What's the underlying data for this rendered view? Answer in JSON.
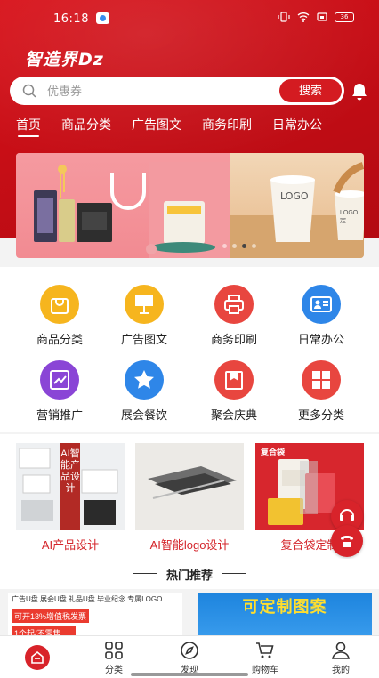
{
  "status_bar": {
    "time": "16:18",
    "battery": "36"
  },
  "app": {
    "logo": "智造界Dz"
  },
  "search": {
    "placeholder": "优惠券",
    "button": "搜索"
  },
  "tabs": [
    {
      "label": "首页",
      "active": true
    },
    {
      "label": "商品分类",
      "active": false
    },
    {
      "label": "广告图文",
      "active": false
    },
    {
      "label": "商务印刷",
      "active": false
    },
    {
      "label": "日常办公",
      "active": false
    }
  ],
  "banner": {
    "logo_text": "LOGO",
    "cup_text": "LOGO定"
  },
  "categories": [
    {
      "label": "商品分类",
      "icon": "shopping-bag-icon",
      "color": "#f6b51e"
    },
    {
      "label": "广告图文",
      "icon": "billboard-icon",
      "color": "#f6b51e"
    },
    {
      "label": "商务印刷",
      "icon": "printer-icon",
      "color": "#e8463f"
    },
    {
      "label": "日常办公",
      "icon": "id-card-icon",
      "color": "#2e86e8"
    },
    {
      "label": "营销推广",
      "icon": "trend-chart-icon",
      "color": "#8a45d6"
    },
    {
      "label": "展会餐饮",
      "icon": "star-icon",
      "color": "#2e86e8"
    },
    {
      "label": "聚会庆典",
      "icon": "gift-icon",
      "color": "#e8463f"
    },
    {
      "label": "更多分类",
      "icon": "grid-icon",
      "color": "#e8463f"
    }
  ],
  "promos": [
    {
      "caption": "AI产品设计",
      "overlay": "AI智能产品设计"
    },
    {
      "caption": "AI智能logo设计"
    },
    {
      "caption": "复合袋定制",
      "tag": "复合袋"
    }
  ],
  "hot": {
    "title": "热门推荐"
  },
  "goods": {
    "left": {
      "chips": "广告U盘  展会U盘  礼品U盘  毕业纪念  专属LOGO",
      "badge1": "可开13%增值税发票",
      "badge2": "1个起/不零售"
    },
    "right": {
      "title": "可定制图案"
    }
  },
  "bottom_nav": [
    {
      "label": "",
      "icon": "home-icon"
    },
    {
      "label": "分类",
      "icon": "category-icon"
    },
    {
      "label": "发现",
      "icon": "compass-icon"
    },
    {
      "label": "购物车",
      "icon": "cart-icon"
    },
    {
      "label": "我的",
      "icon": "user-icon"
    }
  ],
  "colors": {
    "brand_red": "#d41b21",
    "accent_yellow": "#f6b51e",
    "accent_blue": "#2e86e8",
    "accent_purple": "#8a45d6"
  }
}
